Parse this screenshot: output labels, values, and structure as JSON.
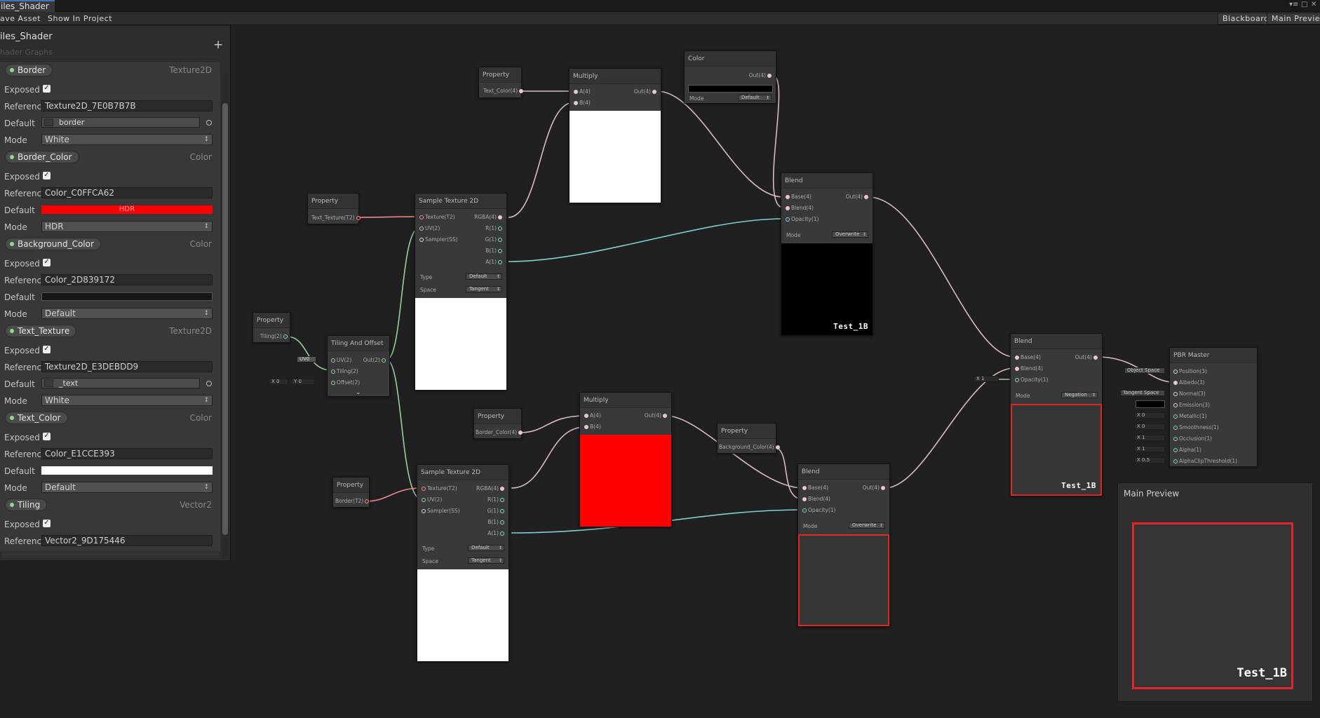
{
  "tab": {
    "title": "Tiles_Shader",
    "visible_title": "iles_Shader"
  },
  "window_controls": [
    "▾≡",
    "□",
    "✕"
  ],
  "toolbar": {
    "save_asset": "Save Asset",
    "visible_save": "ave Asset",
    "show_in_project": "Show In Project",
    "blackboard": "Blackboard",
    "main_preview": "Main Preview"
  },
  "blackboard": {
    "title": "iles_Shader",
    "subtitle": "hader Graphs",
    "add_button": "+",
    "properties": [
      {
        "name": "Border",
        "type": "Texture2D",
        "exposed": true,
        "reference": "Texture2D_7E0B7B7B",
        "default": "border",
        "default_kind": "texture",
        "mode": "White"
      },
      {
        "name": "Border_Color",
        "type": "Color",
        "exposed": true,
        "reference": "Color_C0FFCA62",
        "default": "HDR",
        "default_kind": "color",
        "default_color": "#ff0000",
        "mode": "HDR"
      },
      {
        "name": "Background_Color",
        "type": "Color",
        "exposed": true,
        "reference": "Color_2D839172",
        "default": "",
        "default_kind": "color",
        "default_color": "#161616",
        "mode": "Default"
      },
      {
        "name": "Text_Texture",
        "type": "Texture2D",
        "exposed": true,
        "reference": "Texture2D_E3DEBDD9",
        "default": "_text",
        "default_kind": "texture",
        "mode": "White"
      },
      {
        "name": "Text_Color",
        "type": "Color",
        "exposed": true,
        "reference": "Color_E1CCE393",
        "default": "",
        "default_kind": "color",
        "default_color": "#ffffff",
        "mode": "Default"
      },
      {
        "name": "Tiling",
        "type": "Vector2",
        "exposed": true,
        "reference": "Vector2_9D175446"
      }
    ],
    "labels": {
      "exposed": "Exposed",
      "reference": "Reference",
      "default": "Default",
      "mode": "Mode"
    }
  },
  "nodes": {
    "prop_text_color": {
      "title": "Property",
      "out": "Text_Color(4)"
    },
    "multiply1": {
      "title": "Multiply",
      "in": [
        "A(4)",
        "B(4)"
      ],
      "out": "Out(4)",
      "preview": "#ffffff"
    },
    "color": {
      "title": "Color",
      "out": "Out(4)",
      "mode_label": "Mode",
      "mode": "Default",
      "swatch": "#000000"
    },
    "prop_text_texture": {
      "title": "Property",
      "out": "Text_Texture(T2)"
    },
    "sample1": {
      "title": "Sample Texture 2D",
      "in": [
        "Texture(T2)",
        "UV(2)",
        "Sampler(SS)"
      ],
      "out": [
        "RGBA(4)",
        "R(1)",
        "G(1)",
        "B(1)",
        "A(1)"
      ],
      "type_label": "Type",
      "type": "Default",
      "space_label": "Space",
      "space": "Tangent",
      "preview": "#ffffff"
    },
    "blend1": {
      "title": "Blend",
      "in": [
        "Base(4)",
        "Blend(4)",
        "Opacity(1)"
      ],
      "out": "Out(4)",
      "mode_label": "Mode",
      "mode": "Overwrite",
      "preview": "#000000",
      "preview_text": "Test_1B"
    },
    "prop_tiling": {
      "title": "Property",
      "out": "Tiling(2)"
    },
    "tiling": {
      "title": "Tiling And Offset",
      "in": [
        "UV(2)",
        "Tiling(2)",
        "Offset(2)"
      ],
      "out": "Out(2)",
      "uv_inline": "UV0",
      "offset_inline": [
        "X 0",
        "Y 0"
      ]
    },
    "prop_border_color": {
      "title": "Property",
      "out": "Border_Color(4)"
    },
    "multiply2": {
      "title": "Multiply",
      "in": [
        "A(4)",
        "B(4)"
      ],
      "out": "Out(4)",
      "preview": "#ff0000"
    },
    "prop_bg_color": {
      "title": "Property",
      "out": "Background_Color(4)"
    },
    "prop_border": {
      "title": "Property",
      "out": "Border(T2)"
    },
    "sample2": {
      "title": "Sample Texture 2D",
      "in": [
        "Texture(T2)",
        "UV(2)",
        "Sampler(SS)"
      ],
      "out": [
        "RGBA(4)",
        "R(1)",
        "G(1)",
        "B(1)",
        "A(1)"
      ],
      "type_label": "Type",
      "type": "Default",
      "space_label": "Space",
      "space": "Tangent",
      "preview": "#ffffff"
    },
    "blend2": {
      "title": "Blend",
      "in": [
        "Base(4)",
        "Blend(4)",
        "Opacity(1)"
      ],
      "out": "Out(4)",
      "mode_label": "Mode",
      "mode": "Overwrite",
      "preview": "#353535"
    },
    "blend3": {
      "title": "Blend",
      "in": [
        "Base(4)",
        "Blend(4)",
        "Opacity(1)"
      ],
      "out": "Out(4)",
      "mode_label": "Mode",
      "mode": "Negation",
      "preview": "#353535",
      "preview_text": "Test_1B",
      "opacity_inline": "X 1"
    },
    "pbr": {
      "title": "PBR Master",
      "in": [
        "Position(3)",
        "Albedo(3)",
        "Normal(3)",
        "Emission(3)",
        "Metallic(1)",
        "Smoothness(1)",
        "Occlusion(1)",
        "Alpha(1)",
        "AlphaClipThreshold(1)"
      ],
      "inline": [
        "Object Space",
        "",
        "Tangent Space",
        "",
        "X 0",
        "X 0",
        "X 1",
        "X 1",
        "X 0.5"
      ]
    }
  },
  "main_preview": {
    "title": "Main Preview",
    "text": "Test_1B",
    "border_color": "#e02626"
  }
}
